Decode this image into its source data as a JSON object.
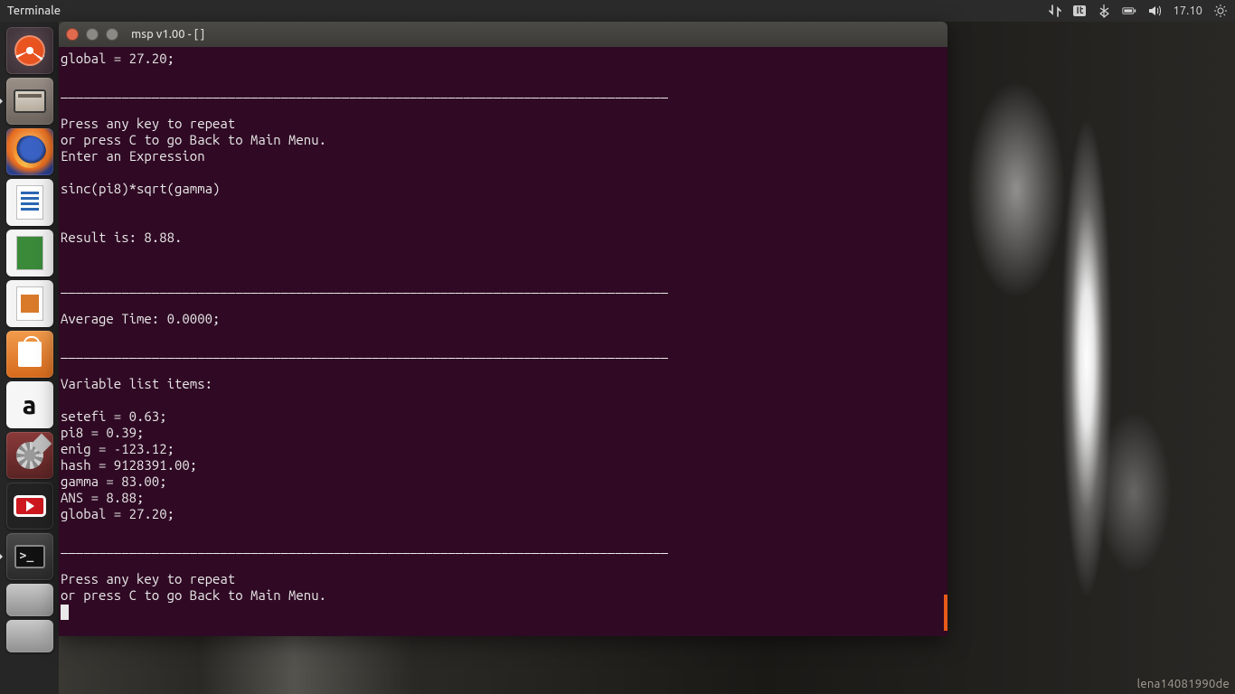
{
  "panel": {
    "app_title": "Terminale",
    "keyboard_layout": "It",
    "clock": "17.10"
  },
  "launcher": {
    "items": [
      {
        "id": "dash",
        "label": "Dash"
      },
      {
        "id": "files",
        "label": "File"
      },
      {
        "id": "firefox",
        "label": "Firefox"
      },
      {
        "id": "writer",
        "label": "LibreOffice Writer"
      },
      {
        "id": "calc",
        "label": "LibreOffice Calc"
      },
      {
        "id": "impress",
        "label": "LibreOffice Impress"
      },
      {
        "id": "software",
        "label": "Ubuntu Software"
      },
      {
        "id": "amazon",
        "label": "Amazon",
        "glyph": "a"
      },
      {
        "id": "settings",
        "label": "Impostazioni"
      },
      {
        "id": "youtube",
        "label": "YouTube"
      },
      {
        "id": "terminal",
        "label": "Terminale",
        "glyph": ">_"
      },
      {
        "id": "device1",
        "label": "Dispositivo"
      },
      {
        "id": "device2",
        "label": "Dispositivo"
      }
    ]
  },
  "terminal": {
    "window_title": "msp v1.00 - [ ]",
    "lines": [
      "global = 27.20;",
      "",
      "________________________________________________________________________________",
      "",
      "Press any key to repeat",
      "or press C to go Back to Main Menu.",
      "Enter an Expression",
      "",
      "sinc(pi8)*sqrt(gamma)",
      "",
      "",
      "Result is: 8.88.",
      "",
      "",
      "________________________________________________________________________________",
      "",
      "Average Time: 0.0000;",
      "",
      "________________________________________________________________________________",
      "",
      "Variable list items:",
      "",
      "setefi = 0.63;",
      "pi8 = 0.39;",
      "enig = -123.12;",
      "hash = 9128391.00;",
      "gamma = 83.00;",
      "ANS = 8.88;",
      "global = 27.20;",
      "",
      "________________________________________________________________________________",
      "",
      "Press any key to repeat",
      "or press C to go Back to Main Menu."
    ]
  },
  "wallpaper": {
    "watermark": "lena14081990de"
  }
}
